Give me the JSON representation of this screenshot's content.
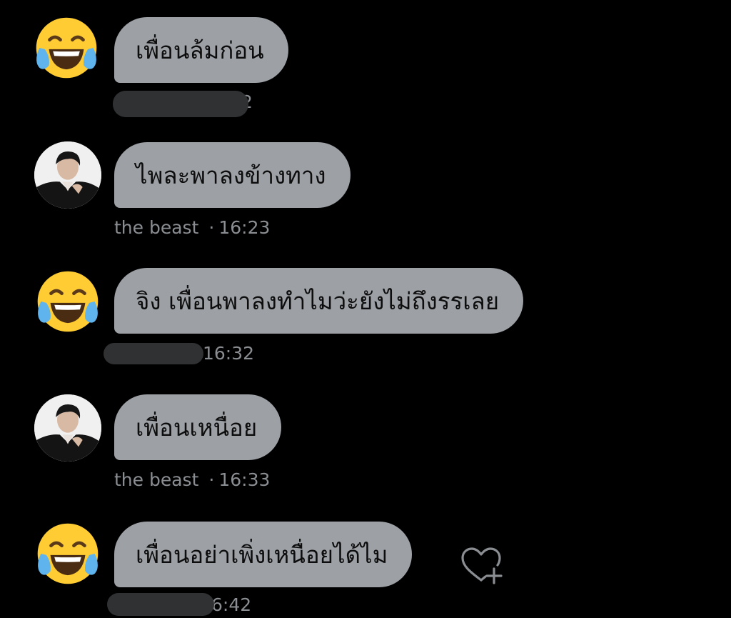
{
  "messages": [
    {
      "id": "m1",
      "avatar_icon": "face-with-tears-of-joy-icon",
      "text": "เพื่อนล้มก่อน",
      "meta_visible_suffix": "2",
      "redacted_sender": true
    },
    {
      "id": "m2",
      "avatar_icon": "profile-photo",
      "text": "ไพละพาลงข้างทาง",
      "sender": "the beast",
      "separator": "·",
      "time": "16:23"
    },
    {
      "id": "m3",
      "avatar_icon": "face-with-tears-of-joy-icon",
      "text": "จิง เพื่อนพาลงทำไมว่ะยังไม่ถึงรรเลย",
      "meta_visible_suffix": "16:32",
      "redacted_sender": true
    },
    {
      "id": "m4",
      "avatar_icon": "profile-photo",
      "text": "เพื่อนเหนื่อย",
      "sender": "the beast",
      "separator": "·",
      "time": "16:33"
    },
    {
      "id": "m5",
      "avatar_icon": "face-with-tears-of-joy-icon",
      "text": "เพื่อนอย่าเพิ่งเหนื่อยได้ไม",
      "meta_visible_suffix": "6:42",
      "redacted_sender": true,
      "reaction_icon": "add-reaction-heart-icon"
    }
  ],
  "colors": {
    "background": "#000000",
    "bubble": "#9da1a6",
    "bubble_text": "#0d0d0d",
    "meta_text": "#8a8d91",
    "redaction": "#2f3133"
  }
}
